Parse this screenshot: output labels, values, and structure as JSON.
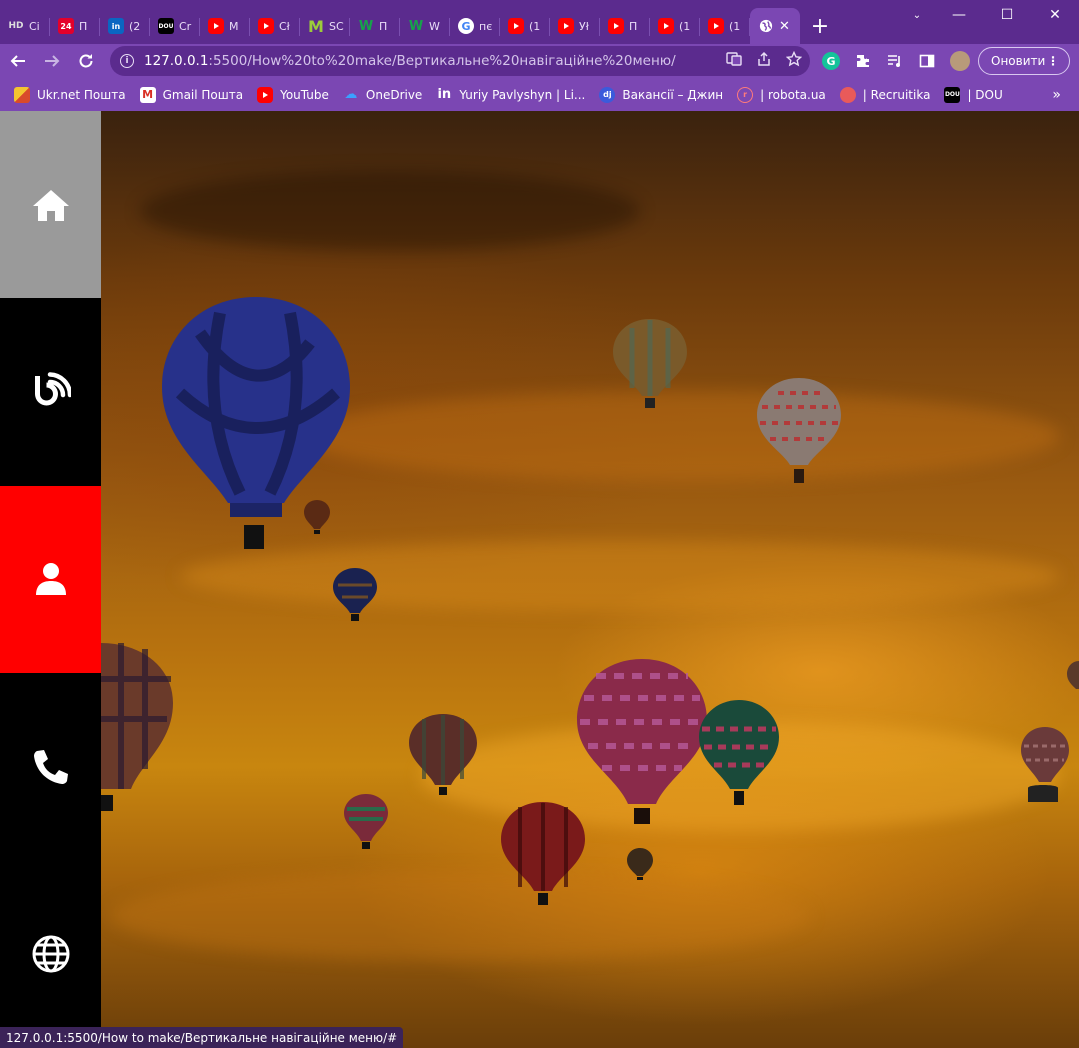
{
  "browser": {
    "tabs": [
      {
        "favicon": "hd-icon",
        "label": "Ci"
      },
      {
        "favicon": "24-icon",
        "label": "П"
      },
      {
        "favicon": "linkedin-icon",
        "label": "(2"
      },
      {
        "favicon": "dou-icon",
        "label": "Cr"
      },
      {
        "favicon": "youtube-icon",
        "label": "M"
      },
      {
        "favicon": "youtube-icon",
        "label": "Cł"
      },
      {
        "favicon": "m-icon",
        "label": "SC"
      },
      {
        "favicon": "w-icon",
        "label": "П"
      },
      {
        "favicon": "w-icon",
        "label": "W"
      },
      {
        "favicon": "google-icon",
        "label": "пє"
      },
      {
        "favicon": "youtube-icon",
        "label": "(1"
      },
      {
        "favicon": "youtube-icon",
        "label": "Уł"
      },
      {
        "favicon": "youtube-icon",
        "label": "П"
      },
      {
        "favicon": "youtube-icon",
        "label": "(1"
      },
      {
        "favicon": "youtube-icon",
        "label": "(1"
      }
    ],
    "active_tab": {
      "favicon": "globe-icon",
      "close": "✕"
    },
    "new_tab": "+",
    "window_controls": {
      "dropdown": "⌄",
      "minimize": "—",
      "maximize": "☐",
      "close": "✕"
    },
    "address": {
      "host": "127.0.0.1",
      "path": ":5500/How%20to%20make/Вертикальне%20навігаційне%20меню/"
    },
    "update_button": "Оновити",
    "bookmarks": [
      {
        "favicon": "ukrnet-icon",
        "label": "Ukr.net Пошта"
      },
      {
        "favicon": "gmail-icon",
        "label": "Gmail Пошта"
      },
      {
        "favicon": "youtube-icon",
        "label": "YouTube"
      },
      {
        "favicon": "onedrive-icon",
        "label": "OneDrive"
      },
      {
        "favicon": "linkedin-icon",
        "label": "Yuriy Pavlyshyn | Li..."
      },
      {
        "favicon": "djinni-icon",
        "label": "Вакансії – Джин"
      },
      {
        "favicon": "robota-icon",
        "label": "| robota.ua"
      },
      {
        "favicon": "recruitika-icon",
        "label": "| Recruitika"
      },
      {
        "favicon": "dou-icon",
        "label": "| DOU"
      }
    ],
    "bookmarks_more": "»",
    "status_url": "127.0.0.1:5500/How to make/Вертикальне навігаційне меню/#"
  },
  "page": {
    "nav": [
      {
        "icon": "home-icon",
        "active": false,
        "hover": true,
        "bg": "#9a9a9a"
      },
      {
        "icon": "blog-icon",
        "active": false,
        "hover": false,
        "bg": "#000000"
      },
      {
        "icon": "user-icon",
        "active": true,
        "hover": false,
        "bg": "#ff0000"
      },
      {
        "icon": "phone-icon",
        "active": false,
        "hover": false,
        "bg": "#000000"
      },
      {
        "icon": "globe-icon",
        "active": false,
        "hover": false,
        "bg": "#000000"
      }
    ],
    "background": "hot-air-balloons-sunset"
  },
  "colors": {
    "chrome": "#5b2b8e",
    "toolbar": "#7b47b3",
    "nav_active": "#ff0000",
    "nav_hover": "#9a9a9a",
    "nav_default": "#000000"
  }
}
